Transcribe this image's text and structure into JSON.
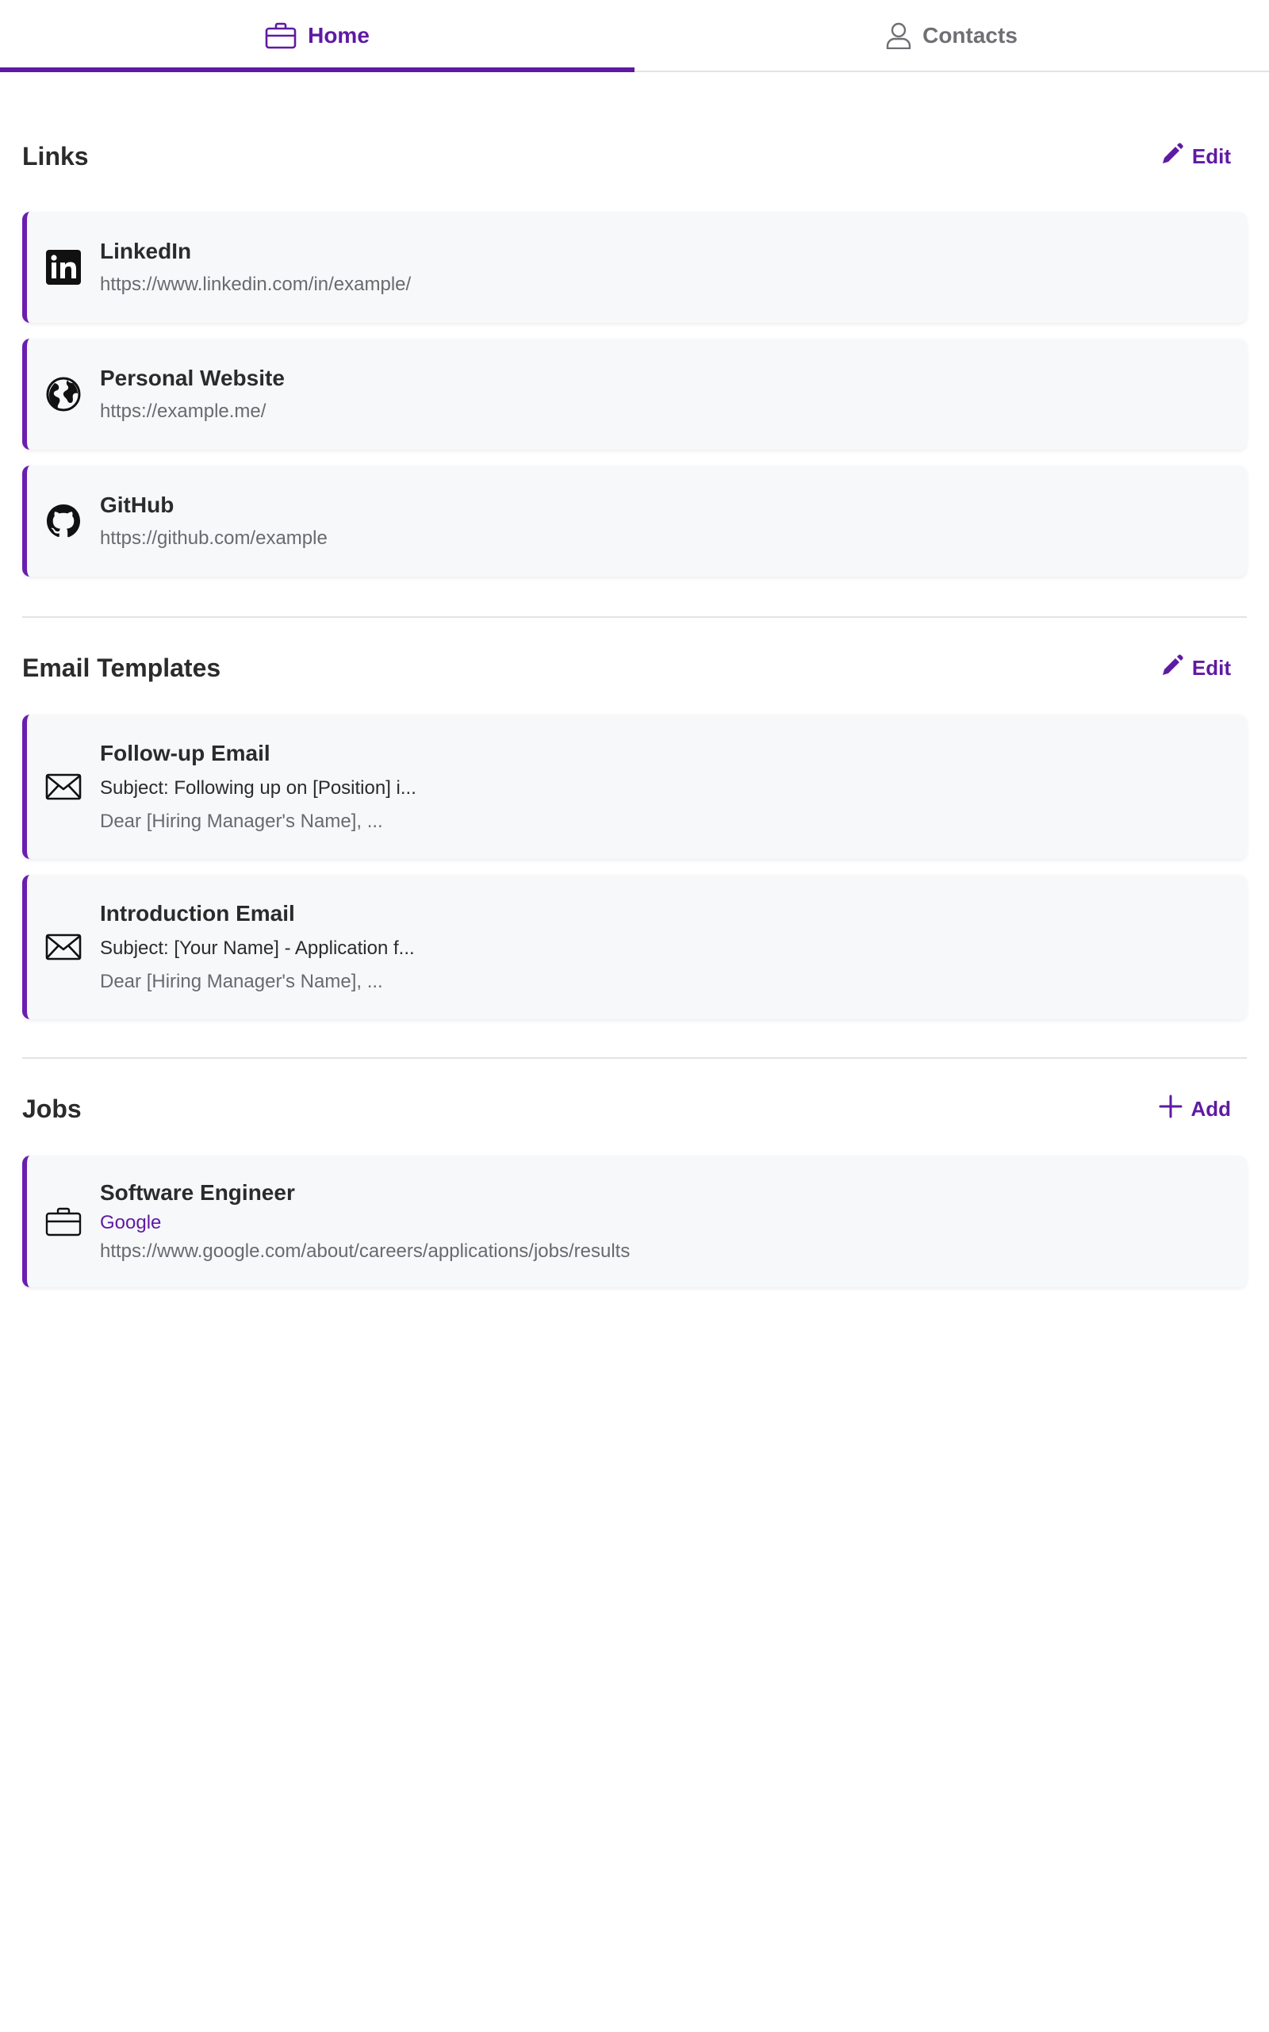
{
  "tabs": [
    {
      "label": "Home",
      "icon": "briefcase-icon",
      "active": true
    },
    {
      "label": "Contacts",
      "icon": "person-icon",
      "active": false
    }
  ],
  "links": {
    "title": "Links",
    "action_label": "Edit",
    "action_icon": "pencil-icon",
    "items": [
      {
        "title": "LinkedIn",
        "url": "https://www.linkedin.com/in/example/",
        "icon": "linkedin-icon"
      },
      {
        "title": "Personal Website",
        "url": "https://example.me/",
        "icon": "globe-icon"
      },
      {
        "title": "GitHub",
        "url": "https://github.com/example",
        "icon": "github-icon"
      }
    ]
  },
  "email_templates": {
    "title": "Email Templates",
    "action_label": "Edit",
    "action_icon": "pencil-icon",
    "items": [
      {
        "title": "Follow-up Email",
        "subject": "Subject: Following up on [Position] i...",
        "preview": "Dear [Hiring Manager's Name], ...",
        "icon": "envelope-icon"
      },
      {
        "title": "Introduction Email",
        "subject": "Subject: [Your Name] - Application f...",
        "preview": "Dear [Hiring Manager's Name], ...",
        "icon": "envelope-icon"
      }
    ]
  },
  "jobs": {
    "title": "Jobs",
    "action_label": "Add",
    "action_icon": "plus-icon",
    "items": [
      {
        "title": "Software Engineer",
        "company": "Google",
        "url": "https://www.google.com/about/careers/applications/jobs/results",
        "icon": "briefcase-icon"
      }
    ]
  },
  "colors": {
    "accent": "#5f1aa3",
    "card_bg": "#f7f8fa",
    "divider": "#e3e3e6"
  }
}
